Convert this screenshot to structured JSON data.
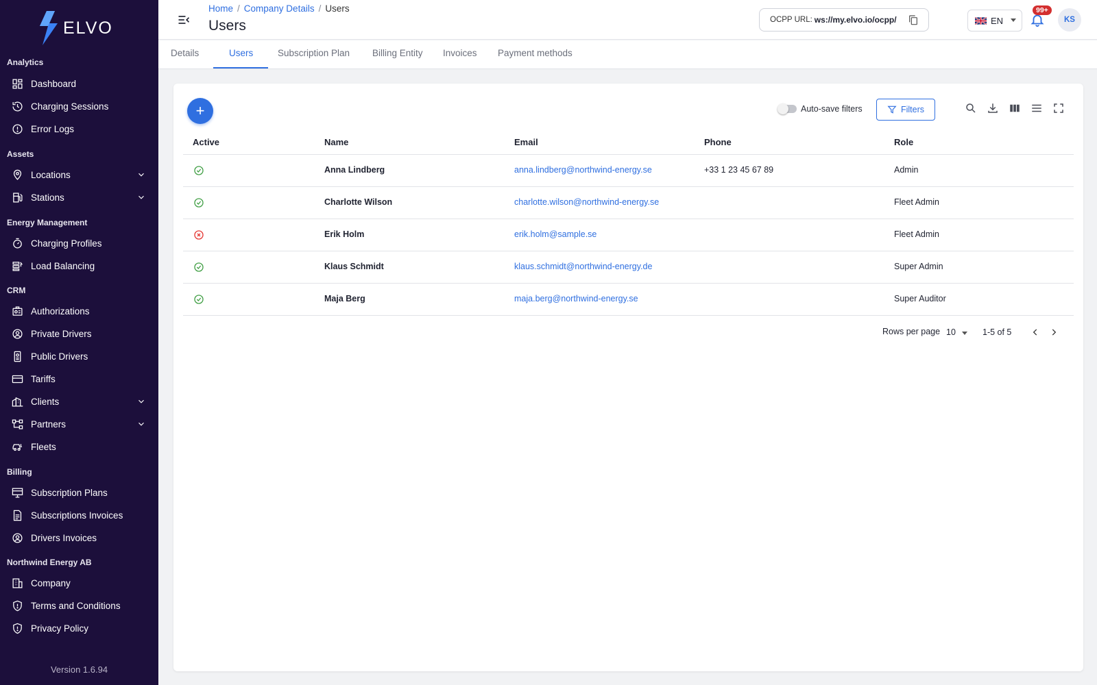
{
  "app": {
    "logo_text": "ELVO",
    "version": "Version 1.6.94"
  },
  "colors": {
    "sidebar_bg": "#1c0f3b",
    "accent": "#2f6fe0",
    "active_ok": "#43a047",
    "inactive": "#e53935",
    "badge": "#d32f2f"
  },
  "sidebar": {
    "sections": {
      "analytics": "Analytics",
      "assets": "Assets",
      "energy": "Energy Management",
      "crm": "CRM",
      "billing": "Billing",
      "company": "Northwind Energy AB"
    },
    "items": {
      "dashboard": "Dashboard",
      "charging_sessions": "Charging Sessions",
      "error_logs": "Error Logs",
      "locations": "Locations",
      "stations": "Stations",
      "charging_profiles": "Charging Profiles",
      "load_balancing": "Load Balancing",
      "authorizations": "Authorizations",
      "private_drivers": "Private Drivers",
      "public_drivers": "Public Drivers",
      "tariffs": "Tariffs",
      "clients": "Clients",
      "partners": "Partners",
      "fleets": "Fleets",
      "subscription_plans": "Subscription Plans",
      "subscriptions_invoices": "Subscriptions Invoices",
      "drivers_invoices": "Drivers Invoices",
      "company": "Company",
      "terms": "Terms and Conditions",
      "privacy": "Privacy Policy"
    }
  },
  "header": {
    "breadcrumb": {
      "home": "Home",
      "company_details": "Company Details",
      "current": "Users",
      "sep": "/"
    },
    "title": "Users",
    "ocpp_label": "OCPP URL:",
    "ocpp_value": "ws://my.elvo.io/ocpp/",
    "language": "EN",
    "notifications_badge": "99+",
    "avatar_initials": "KS"
  },
  "tabs": [
    "Details",
    "Users",
    "Subscription Plan",
    "Billing Entity",
    "Invoices",
    "Payment methods"
  ],
  "active_tab": "Users",
  "toolbar": {
    "auto_save_label": "Auto-save filters",
    "auto_save_on": false,
    "filters_label": "Filters",
    "add_label": "+"
  },
  "table": {
    "columns": {
      "active": "Active",
      "name": "Name",
      "email": "Email",
      "phone": "Phone",
      "role": "Role"
    },
    "rows": [
      {
        "active": true,
        "name": "Anna Lindberg",
        "email": "anna.lindberg@northwind-energy.se",
        "phone": "+33 1 23 45 67 89",
        "role": "Admin"
      },
      {
        "active": true,
        "name": "Charlotte Wilson",
        "email": "charlotte.wilson@northwind-energy.se",
        "phone": "",
        "role": "Fleet Admin"
      },
      {
        "active": false,
        "name": "Erik Holm",
        "email": "erik.holm@sample.se",
        "phone": "",
        "role": "Fleet Admin"
      },
      {
        "active": true,
        "name": "Klaus Schmidt",
        "email": "klaus.schmidt@northwind-energy.de",
        "phone": "",
        "role": "Super Admin"
      },
      {
        "active": true,
        "name": "Maja Berg",
        "email": "maja.berg@northwind-energy.se",
        "phone": "",
        "role": "Super Auditor"
      }
    ]
  },
  "pagination": {
    "rows_per_page_label": "Rows per page",
    "rows_per_page": "10",
    "range": "1-5 of 5"
  }
}
